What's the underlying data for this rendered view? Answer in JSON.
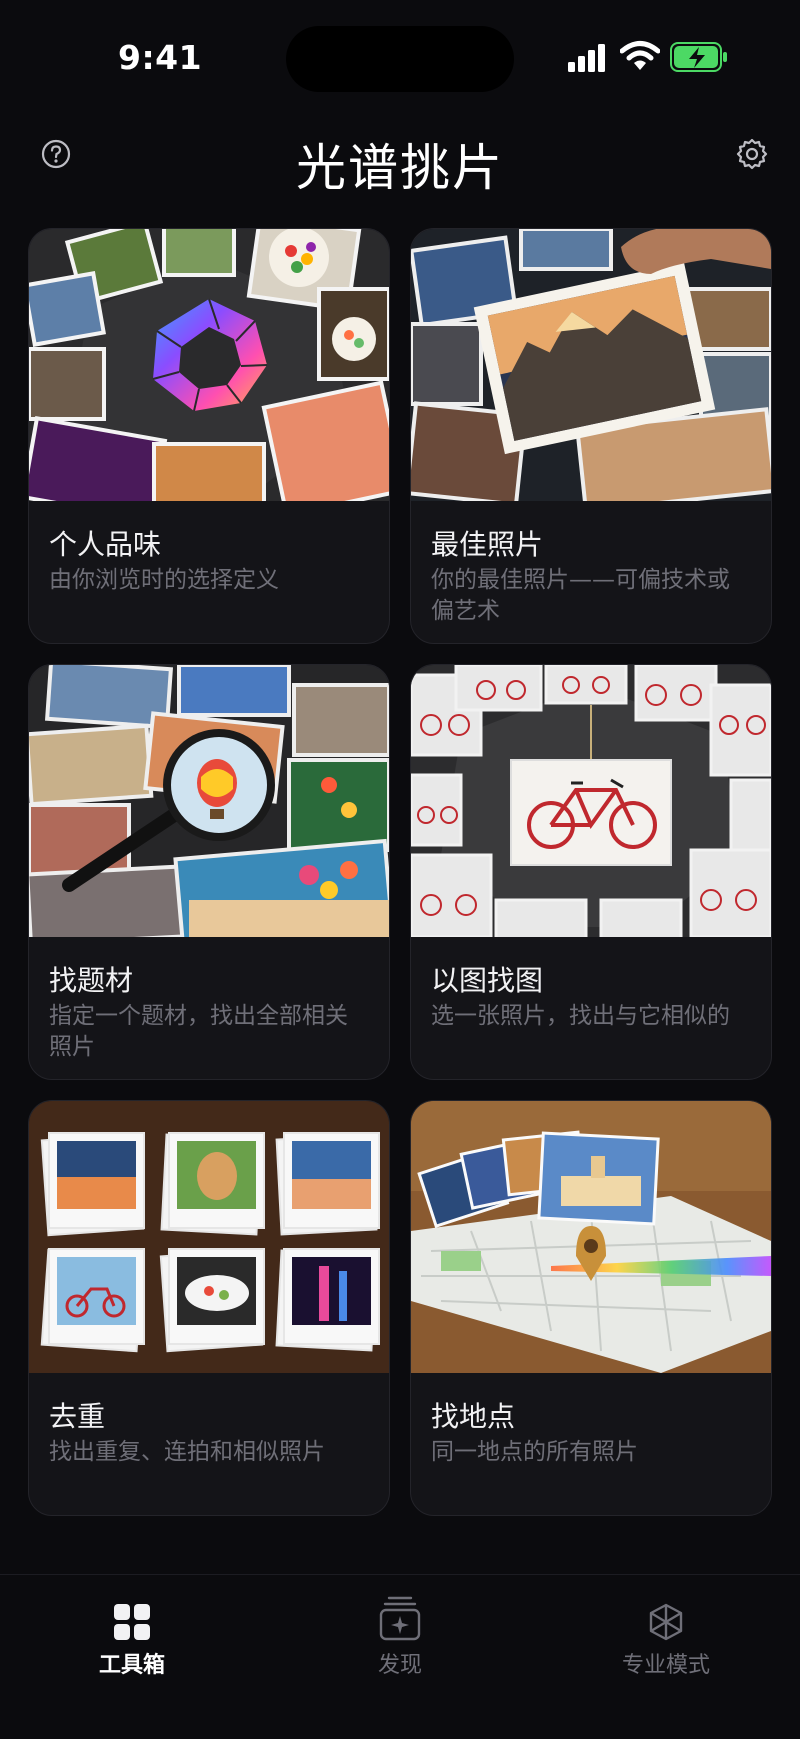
{
  "status_bar": {
    "time": "9:41"
  },
  "header": {
    "title": "光谱挑片",
    "help_icon": "question-circle-icon",
    "settings_icon": "gear-icon"
  },
  "cards": [
    {
      "title": "个人品味",
      "subtitle": "由你浏览时的选择定义",
      "image": "spectrum-aperture-with-photos"
    },
    {
      "title": "最佳照片",
      "subtitle": "你的最佳照片——可偏技术或偏艺术",
      "image": "hand-holding-mountain-photo"
    },
    {
      "title": "找题材",
      "subtitle": "指定一个题材，找出全部相关照片",
      "image": "magnifier-over-photos"
    },
    {
      "title": "以图找图",
      "subtitle": "选一张照片，找出与它相似的",
      "image": "bicycle-photo-ring"
    },
    {
      "title": "去重",
      "subtitle": "找出重复、连拍和相似照片",
      "image": "stacked-photos-grid"
    },
    {
      "title": "找地点",
      "subtitle": "同一地点的所有照片",
      "image": "map-with-location-pin"
    }
  ],
  "tab_bar": {
    "tabs": [
      {
        "label": "工具箱",
        "icon": "grid-icon",
        "active": true
      },
      {
        "label": "发现",
        "icon": "discover-icon",
        "active": false
      },
      {
        "label": "专业模式",
        "icon": "cube-icon",
        "active": false
      }
    ]
  },
  "colors": {
    "background": "#0b0b0e",
    "card": "#141418",
    "subtitle": "#6f6f78",
    "battery": "#4cd964"
  }
}
